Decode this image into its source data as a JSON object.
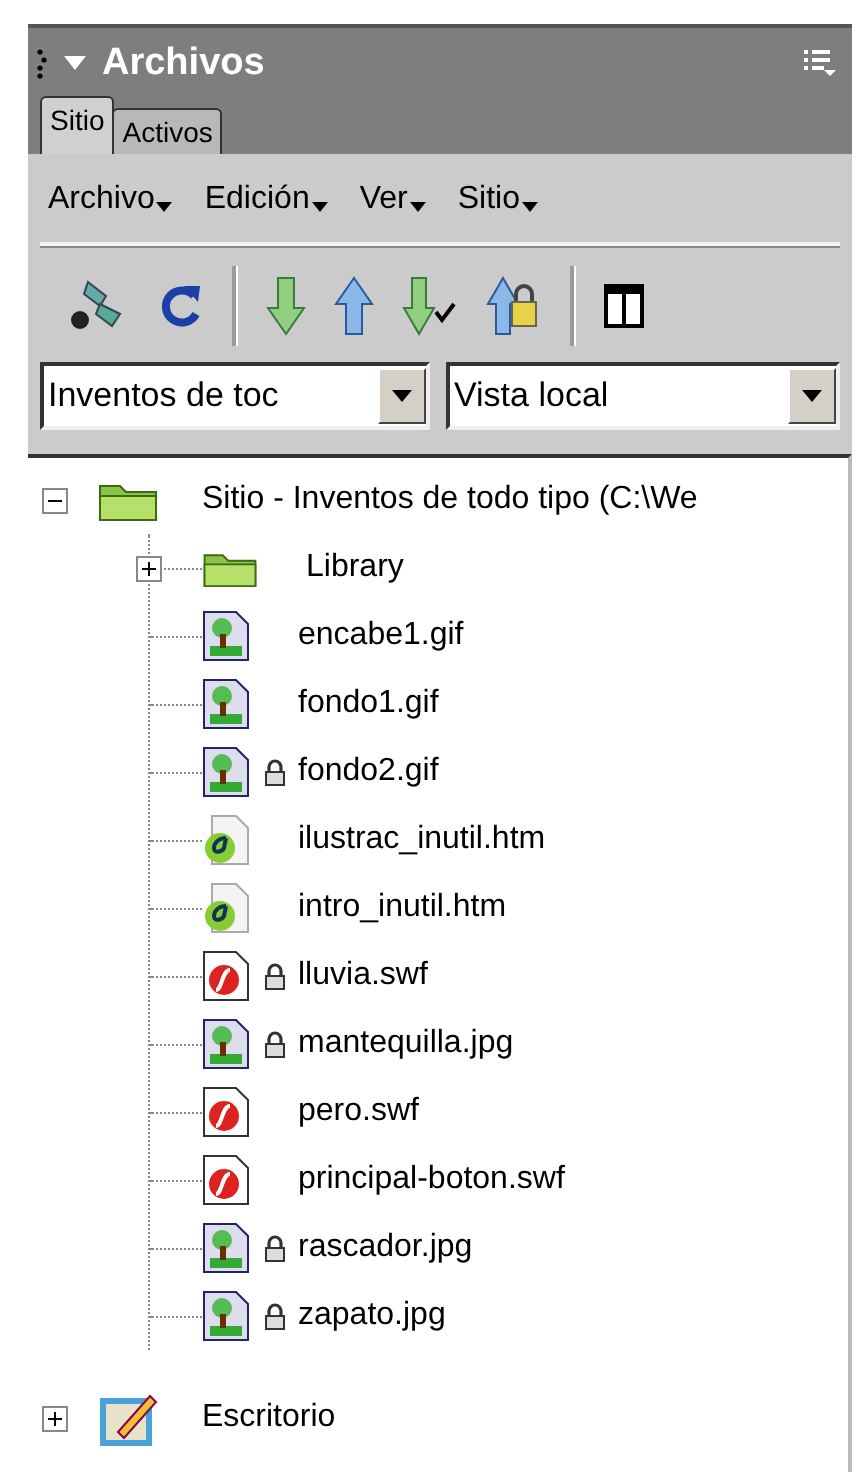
{
  "panel": {
    "title": "Archivos"
  },
  "tabs": [
    {
      "label": "Sitio",
      "selected": true
    },
    {
      "label": "Activos",
      "selected": false
    }
  ],
  "menus": [
    "Archivo",
    "Edición",
    "Ver",
    "Sitio"
  ],
  "site_select": {
    "value": "Inventos de toc"
  },
  "view_select": {
    "value": "Vista local"
  },
  "tree": [
    {
      "kind": "site",
      "label": "Sitio - Inventos de todo tipo (C:\\We",
      "expanded": true,
      "children": [
        {
          "kind": "folder",
          "label": "Library",
          "expanded": false
        },
        {
          "kind": "image",
          "label": "encabe1.gif",
          "locked": false
        },
        {
          "kind": "image",
          "label": "fondo1.gif",
          "locked": false
        },
        {
          "kind": "image",
          "label": "fondo2.gif",
          "locked": true
        },
        {
          "kind": "page",
          "label": "ilustrac_inutil.htm",
          "locked": false
        },
        {
          "kind": "page",
          "label": "intro_inutil.htm",
          "locked": false
        },
        {
          "kind": "flash",
          "label": "lluvia.swf",
          "locked": true
        },
        {
          "kind": "image",
          "label": "mantequilla.jpg",
          "locked": true
        },
        {
          "kind": "flash",
          "label": "pero.swf",
          "locked": false
        },
        {
          "kind": "flash",
          "label": "principal-boton.swf",
          "locked": false
        },
        {
          "kind": "image",
          "label": "rascador.jpg",
          "locked": true
        },
        {
          "kind": "image",
          "label": "zapato.jpg",
          "locked": true
        }
      ]
    },
    {
      "kind": "desktop",
      "label": "Escritorio",
      "expanded": false
    }
  ]
}
